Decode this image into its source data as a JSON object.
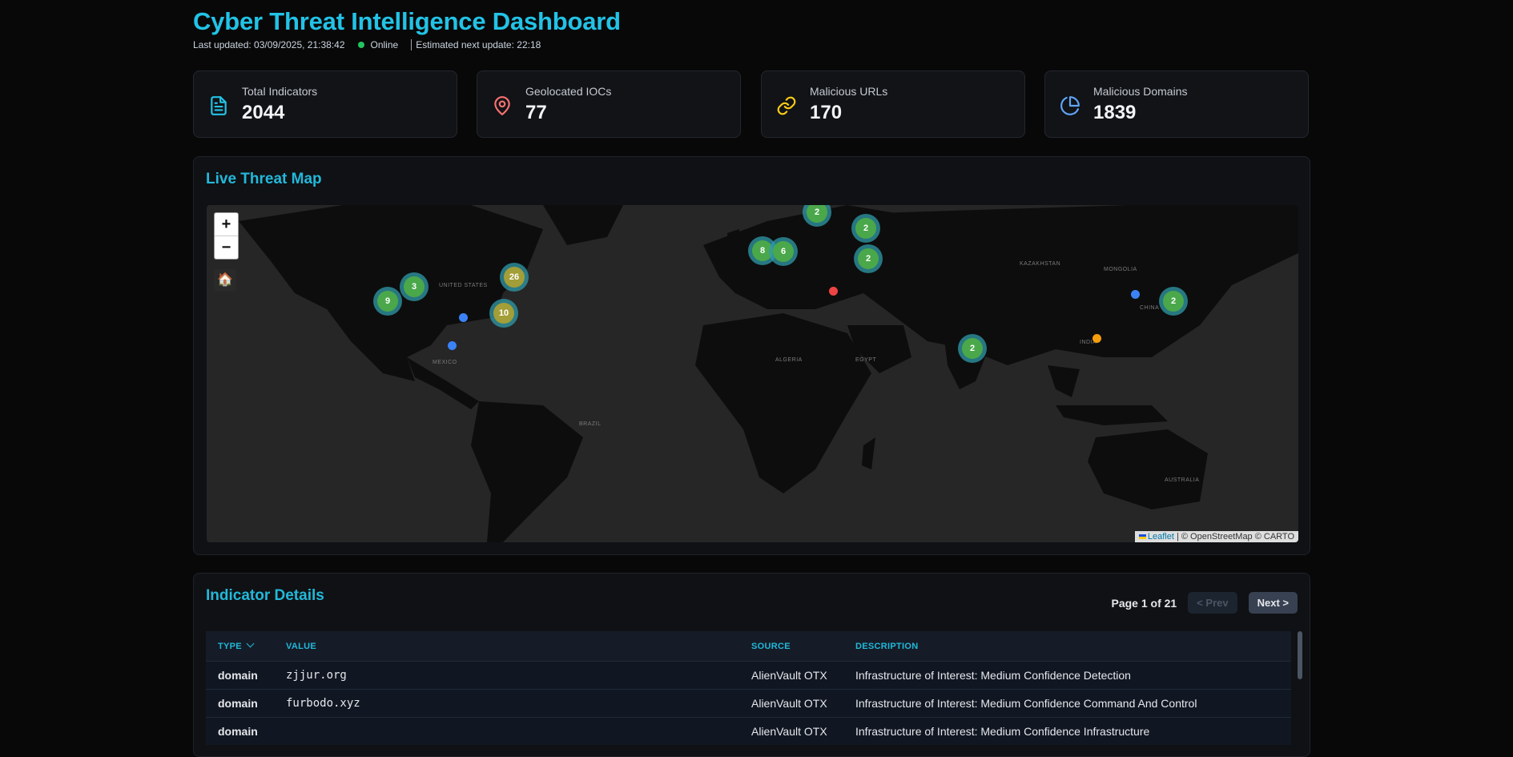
{
  "header": {
    "title": "Cyber Threat Intelligence Dashboard",
    "last_updated": "Last updated: 03/09/2025, 21:38:42",
    "status": "Online",
    "next_update": "Estimated next update: 22:18"
  },
  "stats": [
    {
      "label": "Total Indicators",
      "value": "2044",
      "icon": "document-icon",
      "color": "#22c3e6"
    },
    {
      "label": "Geolocated IOCs",
      "value": "77",
      "icon": "map-pin-icon",
      "color": "#f87171"
    },
    {
      "label": "Malicious URLs",
      "value": "170",
      "icon": "link-icon",
      "color": "#facc15"
    },
    {
      "label": "Malicious Domains",
      "value": "1839",
      "icon": "globe-pie-icon",
      "color": "#60a5fa"
    }
  ],
  "map": {
    "title": "Live Threat Map",
    "zoom_in": "+",
    "zoom_out": "−",
    "home": "🏠",
    "attribution_link": "Leaflet",
    "attribution_text": " | © OpenStreetMap © CARTO",
    "clusters": [
      "2",
      "2",
      "8",
      "6",
      "2",
      "26",
      "3",
      "9",
      "10",
      "2",
      "2"
    ]
  },
  "details": {
    "title": "Indicator Details",
    "page_info": "Page 1 of 21",
    "prev": "< Prev",
    "next": "Next >",
    "columns": [
      "TYPE",
      "VALUE",
      "SOURCE",
      "DESCRIPTION"
    ],
    "rows": [
      {
        "type": "domain",
        "value": "zjjur.org",
        "source": "AlienVault OTX",
        "description": "Infrastructure of Interest: Medium Confidence Detection"
      },
      {
        "type": "domain",
        "value": "furbodo.xyz",
        "source": "AlienVault OTX",
        "description": "Infrastructure of Interest: Medium Confidence Command And Control"
      },
      {
        "type": "domain",
        "value": "",
        "source": "AlienVault OTX",
        "description": "Infrastructure of Interest: Medium Confidence Infrastructure"
      }
    ]
  }
}
